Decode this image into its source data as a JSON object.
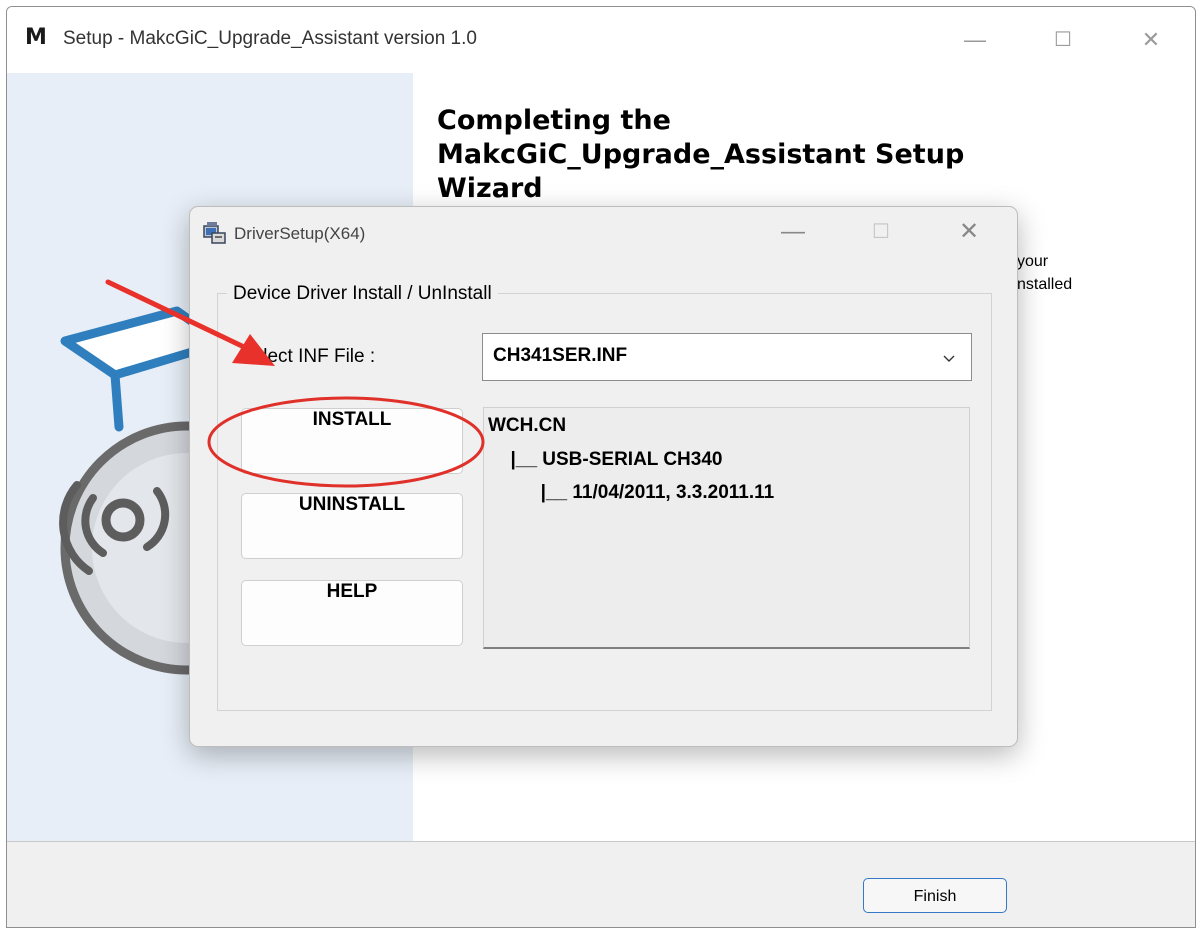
{
  "setup_window": {
    "logo_letter": "M",
    "title": "Setup - MakcGiC_Upgrade_Assistant version 1.0",
    "minimize_glyph": "—",
    "maximize_glyph": "☐",
    "close_glyph": "✕",
    "heading_lines": [
      "Completing the",
      "MakcGiC_Upgrade_Assistant Setup",
      "Wizard"
    ],
    "partial_text_lines": [
      "your",
      "nstalled"
    ],
    "finish_label": "Finish"
  },
  "driver_dialog": {
    "title": "DriverSetup(X64)",
    "minimize_glyph": "—",
    "maximize_glyph": "☐",
    "close_glyph": "✕",
    "group_label": "Device Driver Install / UnInstall",
    "inf_label": "Select INF File :",
    "inf_selected": "CH341SER.INF",
    "buttons": {
      "install": "INSTALL",
      "uninstall": "UNINSTALL",
      "help": "HELP"
    },
    "info_lines": [
      "WCH.CN",
      "  |__ USB-SERIAL CH340",
      "      |__ 11/04/2011, 3.3.2011.11"
    ]
  },
  "annotation": {
    "arrow_color": "#e8312a",
    "circle_color": "#e0302a"
  },
  "icons": [
    "installer-icon",
    "driver-setup-icon",
    "chevron-down-icon",
    "red-arrow-annotation",
    "red-circle-annotation"
  ]
}
